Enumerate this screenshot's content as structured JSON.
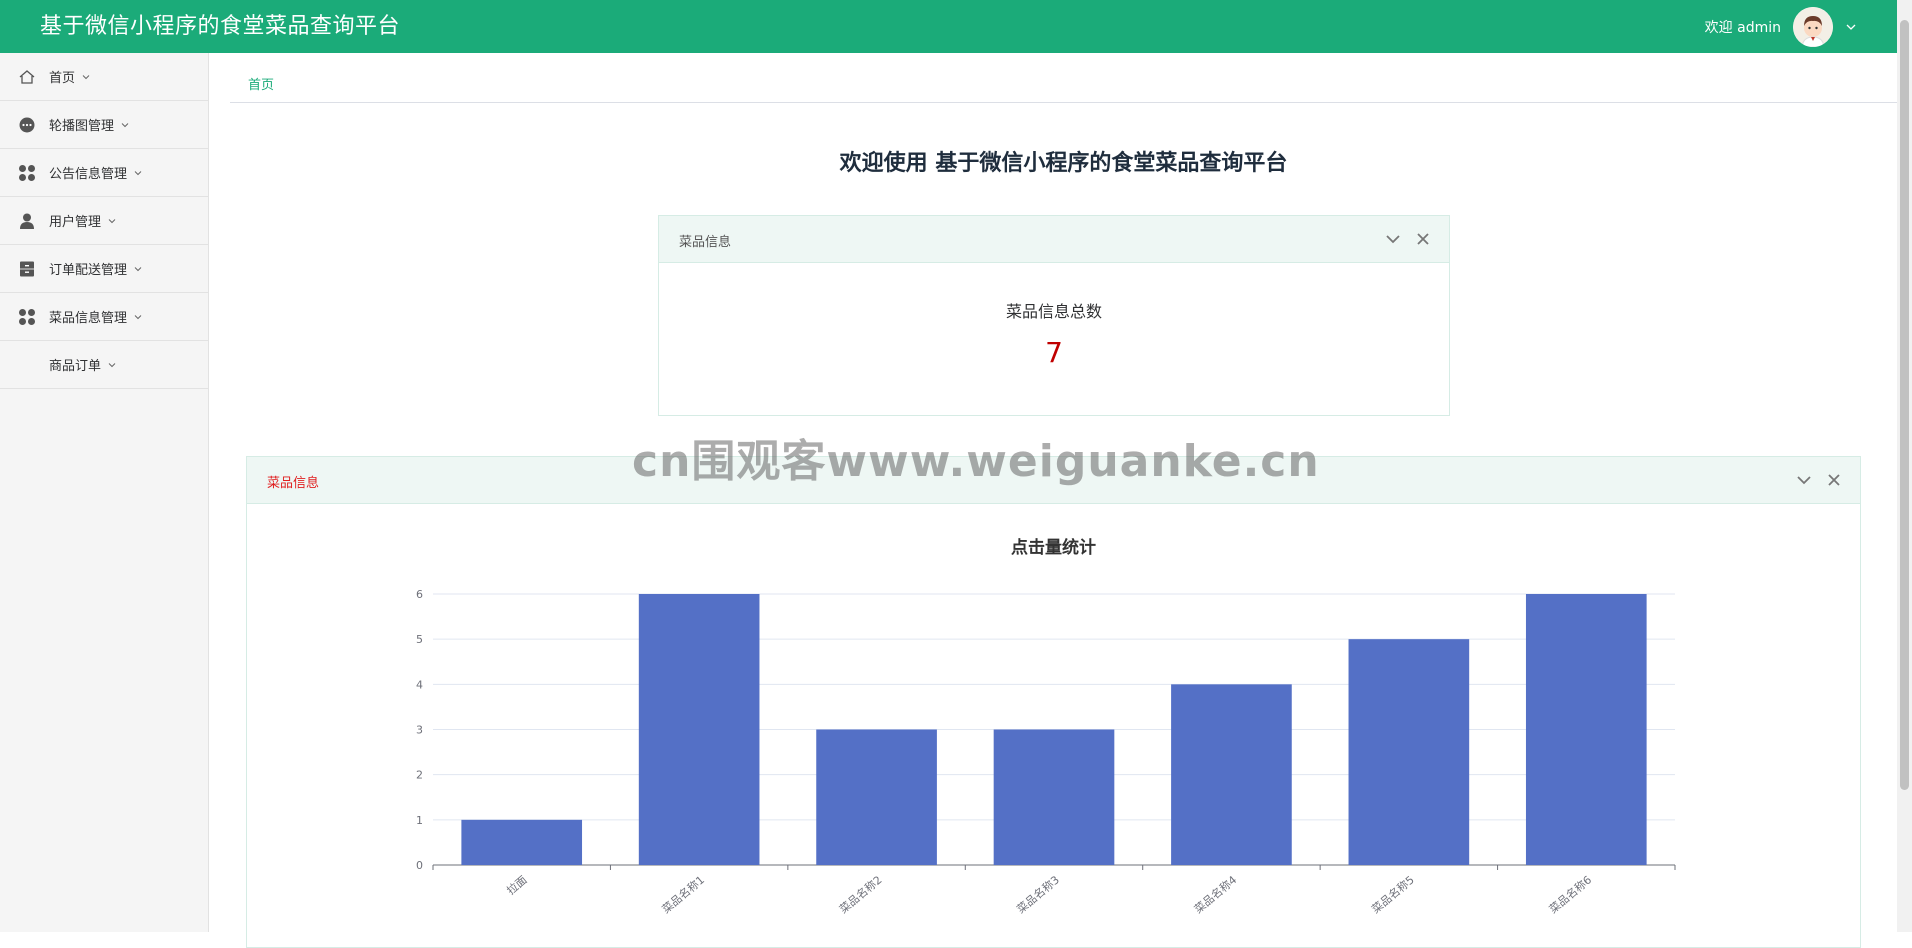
{
  "app": {
    "title": "基于微信小程序的食堂菜品查询平台"
  },
  "user": {
    "welcome": "欢迎 admin"
  },
  "sidebar": {
    "items": [
      {
        "label": "首页",
        "icon": "home-icon"
      },
      {
        "label": "轮播图管理",
        "icon": "carousel-icon"
      },
      {
        "label": "公告信息管理",
        "icon": "grid-icon"
      },
      {
        "label": "用户管理",
        "icon": "user-icon"
      },
      {
        "label": "订单配送管理",
        "icon": "cabinet-icon"
      },
      {
        "label": "菜品信息管理",
        "icon": "grid-icon"
      },
      {
        "label": "商品订单",
        "icon": ""
      }
    ]
  },
  "breadcrumb": {
    "current": "首页"
  },
  "main": {
    "welcome_title": "欢迎使用 基于微信小程序的食堂菜品查询平台",
    "stat_panel": {
      "title": "菜品信息",
      "label": "菜品信息总数",
      "value": "7"
    },
    "chart_panel": {
      "title": "菜品信息"
    }
  },
  "watermark": "cn围观客www.weiguanke.cn",
  "colors": {
    "header": "#1bab79",
    "bar": "#5470c6",
    "stat_value": "#c00000",
    "chart_panel_title": "#e02020"
  },
  "chart_data": {
    "type": "bar",
    "title": "点击量统计",
    "categories": [
      "拉面",
      "菜品名称1",
      "菜品名称2",
      "菜品名称3",
      "菜品名称4",
      "菜品名称5",
      "菜品名称6"
    ],
    "values": [
      1,
      6,
      3,
      3,
      4,
      5,
      6
    ],
    "ylim": [
      0,
      6
    ],
    "yticks": [
      0,
      1,
      2,
      3,
      4,
      5,
      6
    ],
    "xlabel": "",
    "ylabel": "",
    "grid": true
  }
}
